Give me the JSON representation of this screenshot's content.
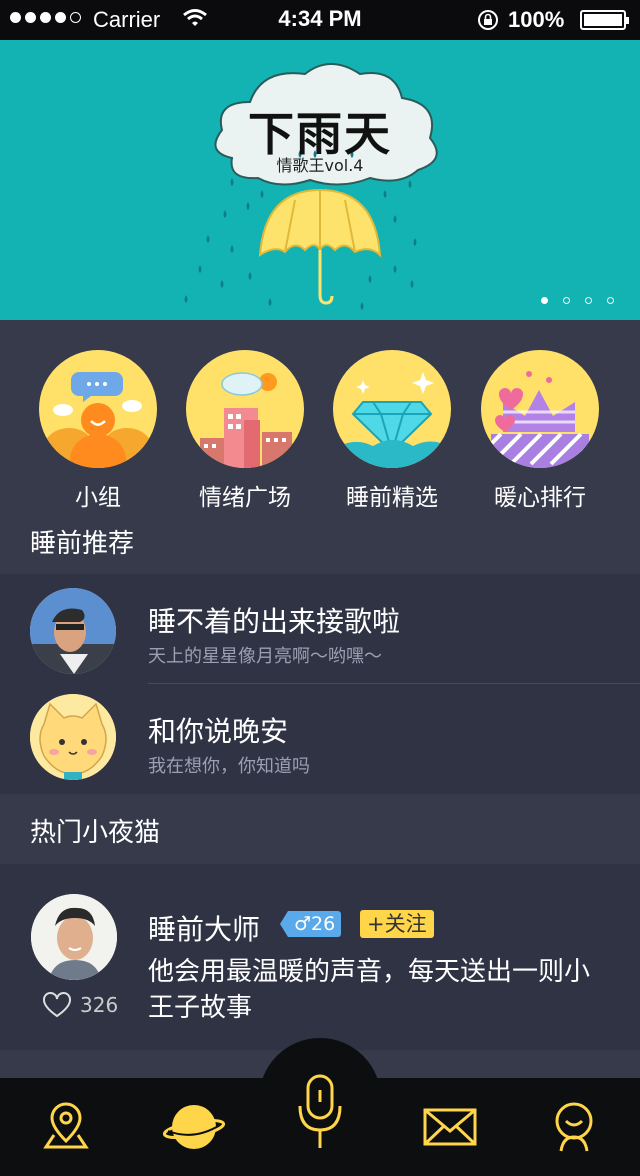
{
  "status_bar": {
    "carrier": "Carrier",
    "time": "4:34 PM",
    "battery": "100%",
    "signal_dots_filled": 4,
    "signal_dots_total": 5
  },
  "banner": {
    "title": "下雨天",
    "subtitle": "情歌王vol.4",
    "pages": 4,
    "active_page": 1,
    "background": "#13b3b4"
  },
  "categories": [
    {
      "label": "小组",
      "icon": "group-icon"
    },
    {
      "label": "情绪广场",
      "icon": "city-icon"
    },
    {
      "label": "睡前精选",
      "icon": "diamond-icon"
    },
    {
      "label": "暖心排行",
      "icon": "crown-icon"
    }
  ],
  "recommend": {
    "heading": "睡前推荐",
    "items": [
      {
        "title": "睡不着的出来接歌啦",
        "subtitle": "天上的星星像月亮啊～哟嘿～"
      },
      {
        "title": "和你说晚安",
        "subtitle": "我在想你，你知道吗"
      }
    ]
  },
  "hot": {
    "heading": "热门小夜猫",
    "user": {
      "name": "睡前大师",
      "age_badge": "♂26",
      "follow_label": "+关注",
      "description": "他会用最温暖的声音，每天送出一则小王子故事",
      "likes": "326"
    }
  },
  "tabbar": {
    "accent": "#ffd54a",
    "items": [
      "location-icon",
      "planet-icon",
      "microphone-icon",
      "mail-icon",
      "profile-icon"
    ]
  }
}
